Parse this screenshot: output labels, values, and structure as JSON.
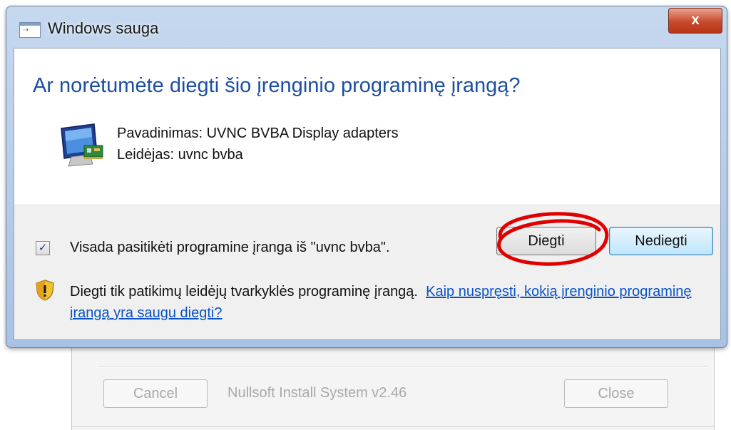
{
  "background_window": {
    "cancel_label": "Cancel",
    "status_label": "Nullsoft Install System v2.46",
    "close_label": "Close"
  },
  "dialog": {
    "title": "Windows sauga",
    "close_glyph": "x",
    "heading": "Ar norėtumėte diegti šio įrenginio programinę įrangą?",
    "name_line": "Pavadinimas: UVNC BVBA Display adapters",
    "publisher_line": "Leidėjas: uvnc bvba",
    "trust_checkbox": {
      "checked": true,
      "label": "Visada pasitikėti programine įranga iš \"uvnc bvba\"."
    },
    "install_button": "Diegti",
    "dont_install_button": "Nediegti",
    "warning_text": "Diegti tik patikimų leidėjų tvarkyklės programinę įrangą.",
    "warning_link": "Kaip nuspręsti, kokią įrenginio programinę įrangą yra saugu diegti?"
  },
  "icons": {
    "title": "window-icon",
    "device": "monitor-device-icon",
    "warning": "shield-warning-icon",
    "annotation": "red-circle-annotation"
  },
  "colors": {
    "heading": "#1c4fa3",
    "link": "#0b53c4",
    "close_button": "#c74a2c",
    "annotation": "#e00000"
  }
}
